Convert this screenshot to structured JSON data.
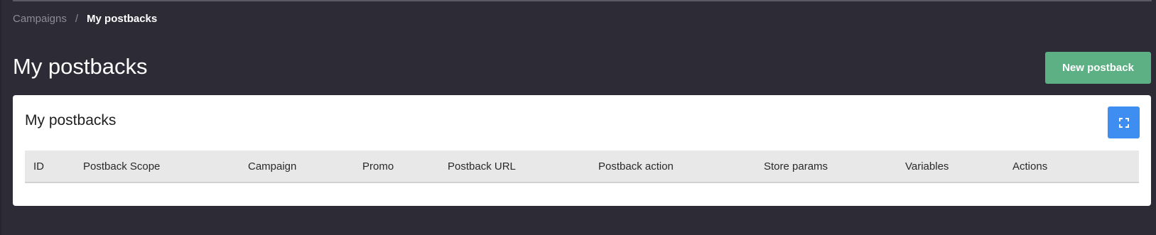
{
  "breadcrumb": {
    "parent": "Campaigns",
    "separator": "/",
    "current": "My postbacks"
  },
  "header": {
    "title": "My postbacks",
    "new_button_label": "New postback"
  },
  "card": {
    "title": "My postbacks",
    "expand_icon": "fullscreen-expand-icon"
  },
  "table": {
    "columns": [
      "ID",
      "Postback Scope",
      "Campaign",
      "Promo",
      "Postback URL",
      "Postback action",
      "Store params",
      "Variables",
      "Actions"
    ],
    "rows": []
  },
  "colors": {
    "background": "#2d2c36",
    "primary_button": "#5daf84",
    "accent_button": "#3d8ef0",
    "card": "#ffffff",
    "table_header": "#e8e8e8"
  }
}
